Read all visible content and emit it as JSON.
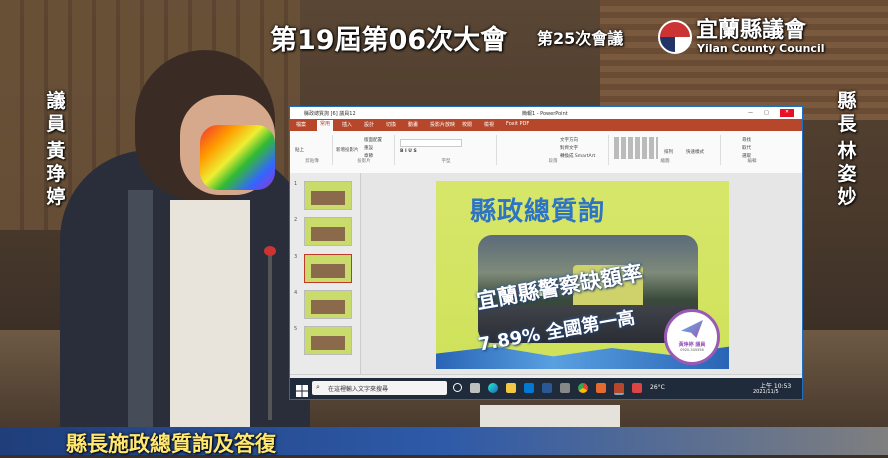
{
  "overlay": {
    "session_title": "第19屆第06次大會",
    "meeting_number": "第25次會議",
    "council_name": "宜蘭縣議會",
    "council_name_en": "Yilan County Council",
    "left_speaker_title": "議員",
    "left_speaker_name": "黃琤婷",
    "right_speaker_title": "縣長",
    "right_speaker_name": "林姿妙",
    "bottom_caption": "縣長施政總質詢及答復"
  },
  "powerpoint": {
    "title_left": "縣政總質詢 [6] 議員12",
    "title_center": "簡報1 - PowerPoint",
    "tabs": [
      "檔案",
      "常用",
      "插入",
      "設計",
      "切換",
      "動畫",
      "投影片放映",
      "校閱",
      "檢視",
      "Foxit PDF"
    ],
    "active_tab": "常用",
    "ribbon_groups": [
      "剪貼簿",
      "投影片",
      "字型",
      "段落",
      "繪圖",
      "編輯"
    ],
    "ribbon_buttons": [
      "貼上",
      "新增投影片",
      "版面配置",
      "重設",
      "章節",
      "文字方向",
      "對齊文字",
      "轉換成 SmartArt",
      "排列",
      "快速樣式",
      "尋找",
      "取代",
      "選取"
    ],
    "slide_numbers": [
      "1",
      "2",
      "3",
      "4",
      "5"
    ],
    "selected_slide": "3",
    "slide": {
      "title": "縣政總質詢",
      "headline": "宜蘭縣警察缺額率",
      "stat": "7.89% 全國第一高",
      "badge_name": "黃琤婷 議員",
      "badge_phone": "0920-345558"
    }
  },
  "taskbar": {
    "search_placeholder": "在這裡輸入文字來搜尋",
    "weather": "26°C",
    "time": "上午 10:53",
    "date": "2021/11/5"
  },
  "colors": {
    "ppt_accent": "#b7472a",
    "slide_bg": "#d7e66a",
    "slide_title": "#2d74c4",
    "caption_yellow": "#ffe770"
  }
}
